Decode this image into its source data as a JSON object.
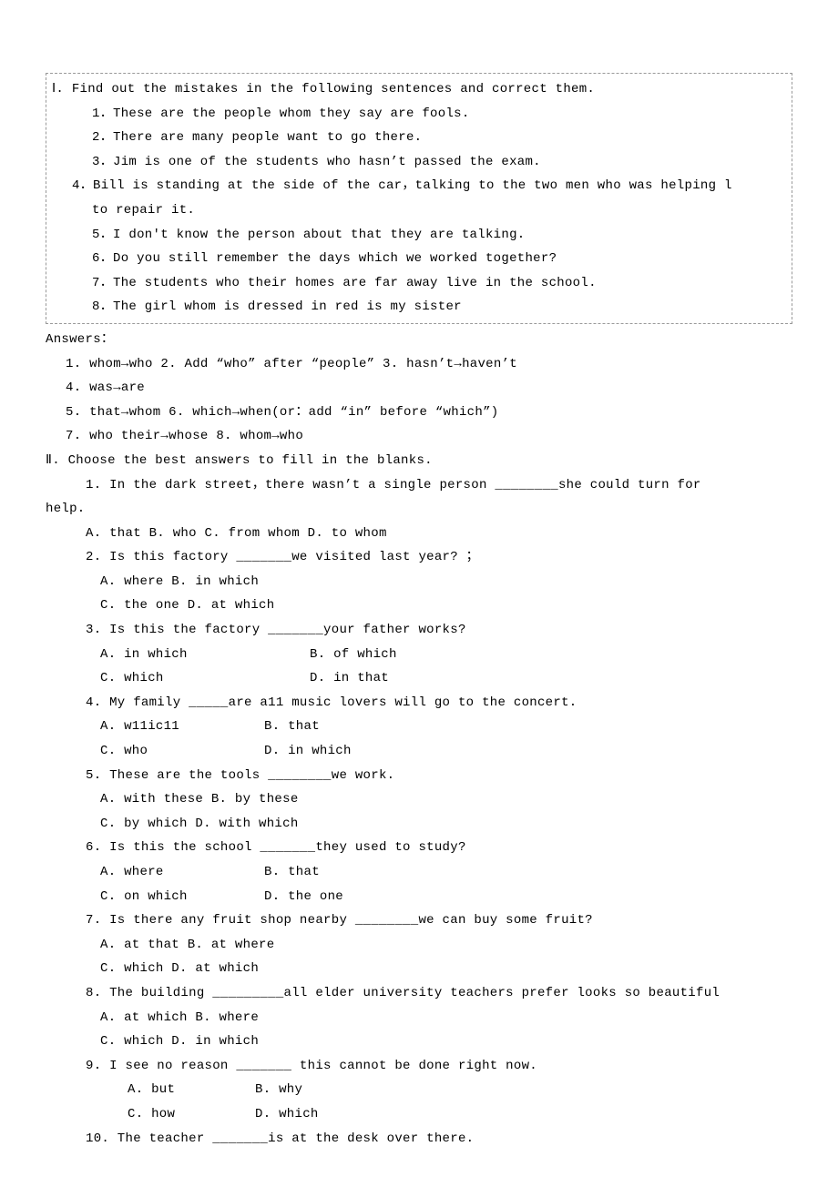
{
  "section1": {
    "heading": "Ⅰ. Find out the mistakes in the following sentences and correct them.",
    "items": [
      "1．These are the people whom they say are fools.",
      "2．There are many people want to go there.",
      "3．Jim is one of the students who hasn’t passed the exam.",
      "4．Bill is standing at the side of the car，talking to the two men who was helping l",
      "to repair it.",
      "5．I don't know the person about that they are talking.",
      "6．Do you still remember the days which we worked together?",
      "7．The students who their homes are far away live in the school.",
      "8．The girl whom is dressed in red is my sister"
    ]
  },
  "answers": {
    "heading": "Answers：",
    "lines": [
      "1. whom→who    2. Add “who” after “people” 3. hasn’t→haven’t",
      "4. was→are",
      "5. that→whom   6. which→when(or：add “in” before “which”)",
      "7. who their→whose  8. whom→who"
    ]
  },
  "section2": {
    "heading": "Ⅱ. Choose the best answers to fill in the blanks.",
    "q1": {
      "stem_a": "1. In the dark street，there wasn’t a single person ________she could turn for",
      "stem_b": "help.",
      "opts": "A. that    B. who  C. from whom   D. to whom"
    },
    "q2": {
      "stem": "2. Is this factory _______we visited last year?   ；",
      "o1": "A. where      B. in which",
      "o2": "C. the one    D. at which"
    },
    "q3": {
      "stem": "3. Is this the factory _______your father works?",
      "o1a": "A. in which",
      "o1b": "B. of which",
      "o2a": "C. which",
      "o2b": "D. in that"
    },
    "q4": {
      "stem": "4. My family _____are a11 music lovers will go to the concert.",
      "o1a": "A. w11ic11",
      "o1b": "B. that",
      "o2a": "C. who",
      "o2b": "D. in which"
    },
    "q5": {
      "stem": "5. These are the tools ________we work.",
      "o1": "A. with these     B. by these",
      "o2": "C. by which      D. with which"
    },
    "q6": {
      "stem": "6. Is this the school _______they used to study?",
      "o1a": "A. where",
      "o1b": "B. that",
      "o2a": "C. on which",
      "o2b": "D. the one"
    },
    "q7": {
      "stem": "7. Is there any fruit shop nearby ________we can buy some fruit?",
      "o1": "A. at that    B. at where",
      "o2": "C. which    D. at which"
    },
    "q8": {
      "stem": "8. The building _________all elder university teachers prefer looks so beautiful",
      "o1": "A. at which      B. where",
      "o2": "C. which        D. in which"
    },
    "q9": {
      "stem": "9. I see no reason _______ this cannot be done right now.",
      "o1a": "A. but",
      "o1b": "B. why",
      "o2a": "C. how",
      "o2b": "D. which"
    },
    "q10": {
      "stem": "10. The teacher _______is at the desk over there."
    }
  }
}
